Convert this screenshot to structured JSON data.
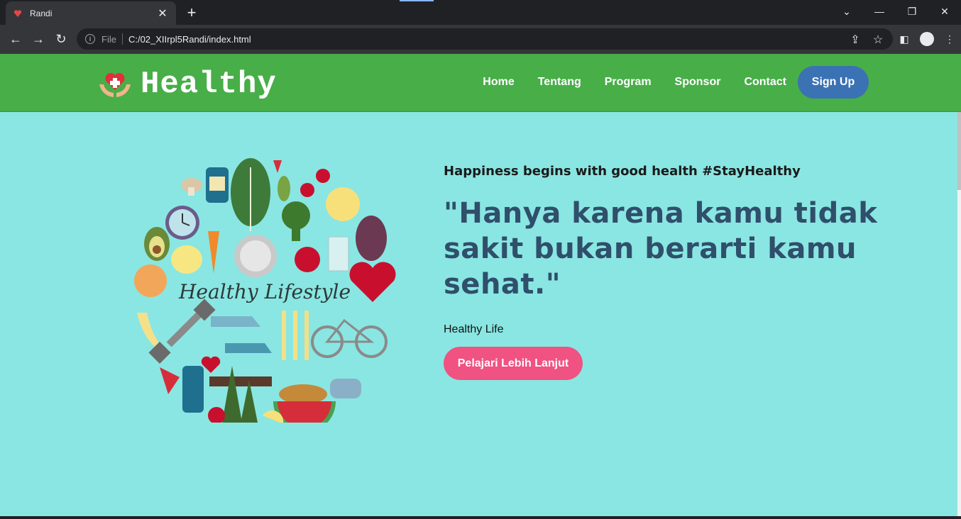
{
  "browser": {
    "tab_title": "Randi",
    "file_label": "File",
    "url": "C:/02_XIIrpl5Randi/index.html"
  },
  "site": {
    "brand": "Healthy",
    "nav": [
      "Home",
      "Tentang",
      "Program",
      "Sponsor",
      "Contact"
    ],
    "signup_label": "Sign Up"
  },
  "hero": {
    "tagline": "Happiness begins with good health #StayHealthy",
    "quote": "\"Hanya karena kamu tidak sakit bukan berarti kamu sehat.\"",
    "subtitle": "Healthy Life",
    "cta_label": "Pelajari Lebih Lanjut",
    "image_text": "Healthy Lifestyle"
  },
  "colors": {
    "navbar": "#48ae48",
    "page_bg": "#8ae6e2",
    "signup": "#3b72b3",
    "cta": "#f05282",
    "quote": "#2f4f6b"
  }
}
